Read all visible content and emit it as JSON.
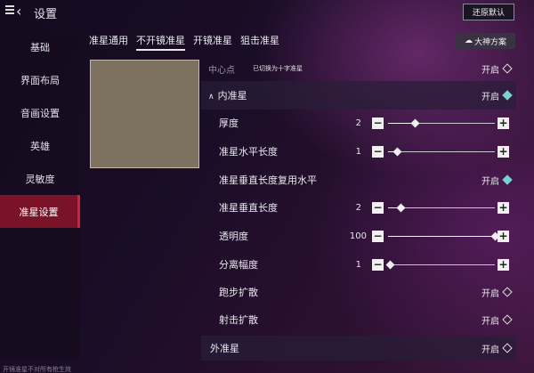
{
  "header": {
    "title": "设置",
    "reset_label": "还原默认"
  },
  "sidebar": {
    "items": [
      {
        "label": "基础",
        "active": false
      },
      {
        "label": "界面布局",
        "active": false
      },
      {
        "label": "音画设置",
        "active": false
      },
      {
        "label": "英雄",
        "active": false
      },
      {
        "label": "灵敏度",
        "active": false
      },
      {
        "label": "准星设置",
        "active": true
      }
    ]
  },
  "tabs": [
    {
      "label": "准星通用",
      "active": false
    },
    {
      "label": "不开镜准星",
      "active": true
    },
    {
      "label": "开镜准星",
      "active": false
    },
    {
      "label": "狙击准星",
      "active": false
    }
  ],
  "master_scheme_label": "大神方案",
  "panel": {
    "center_dot": {
      "label": "中心点",
      "hint": "已切换为十字准星",
      "state": "开启"
    },
    "inner_crosshair": {
      "label": "内准星",
      "state": "开启"
    },
    "thickness": {
      "label": "厚度",
      "value": "2",
      "level": 0.25
    },
    "inner_h_length": {
      "label": "准星水平长度",
      "value": "1",
      "level": 0.08
    },
    "vertical_reuse": {
      "label": "准星垂直长度复用水平",
      "state": "开启"
    },
    "inner_v_length": {
      "label": "准星垂直长度",
      "value": "2",
      "level": 0.12
    },
    "opacity": {
      "label": "透明度",
      "value": "100",
      "level": 1.0
    },
    "separation": {
      "label": "分离幅度",
      "value": "1",
      "level": 0.02
    },
    "run_spread": {
      "label": "跑步扩散",
      "state": "开启"
    },
    "shoot_spread": {
      "label": "射击扩散",
      "state": "开启"
    },
    "outer_crosshair": {
      "label": "外准星",
      "state": "开启"
    }
  },
  "footnote": "开镜准星不对所有枪生效"
}
